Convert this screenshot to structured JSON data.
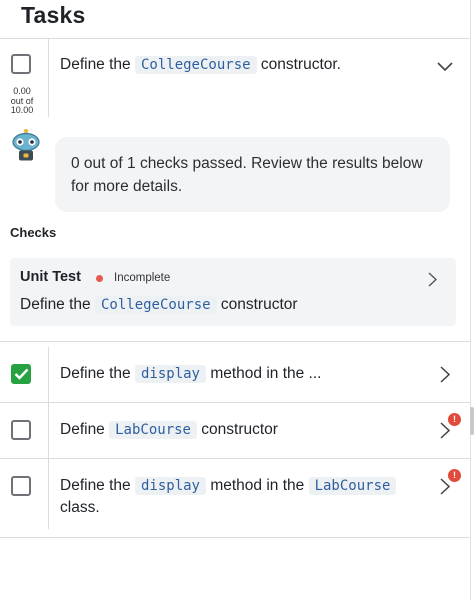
{
  "panel": {
    "title": "Tasks"
  },
  "tasks": [
    {
      "status": "unchecked",
      "text_before": "Define the",
      "code": "CollegeCourse",
      "text_after": "constructor.",
      "score": {
        "value": "0.00",
        "out_of": "out of",
        "max": "10.00"
      },
      "expanded": true
    },
    {
      "status": "checked",
      "text_before": "Define the",
      "code": "display",
      "text_after": "method in the ..."
    },
    {
      "status": "unchecked",
      "text_before": "Define",
      "code": "LabCourse",
      "text_after": "constructor",
      "badge": "!"
    },
    {
      "status": "unchecked",
      "text_before": "Define the",
      "code": "display",
      "text_middle": "method in the",
      "code2": "LabCourse",
      "text_after": "class.",
      "badge": "!"
    }
  ],
  "feedback": {
    "line1": "0 out of 1 checks passed. Review the results below",
    "line2": "for more details."
  },
  "checks": {
    "heading": "Checks",
    "items": [
      {
        "title": "Unit Test",
        "status": "Incomplete",
        "text_before": "Define the",
        "code": "CollegeCourse",
        "text_after": "constructor"
      }
    ]
  },
  "colors": {
    "check_green": "#27a243",
    "incomplete_red": "#e35a4f",
    "badge_red": "#e24a3b",
    "code_blue": "#2e5f9e"
  },
  "icons": [
    "robot-avatar-icon",
    "chevron-down-icon",
    "chevron-right-icon",
    "checkmark-icon",
    "alert-badge-icon"
  ]
}
